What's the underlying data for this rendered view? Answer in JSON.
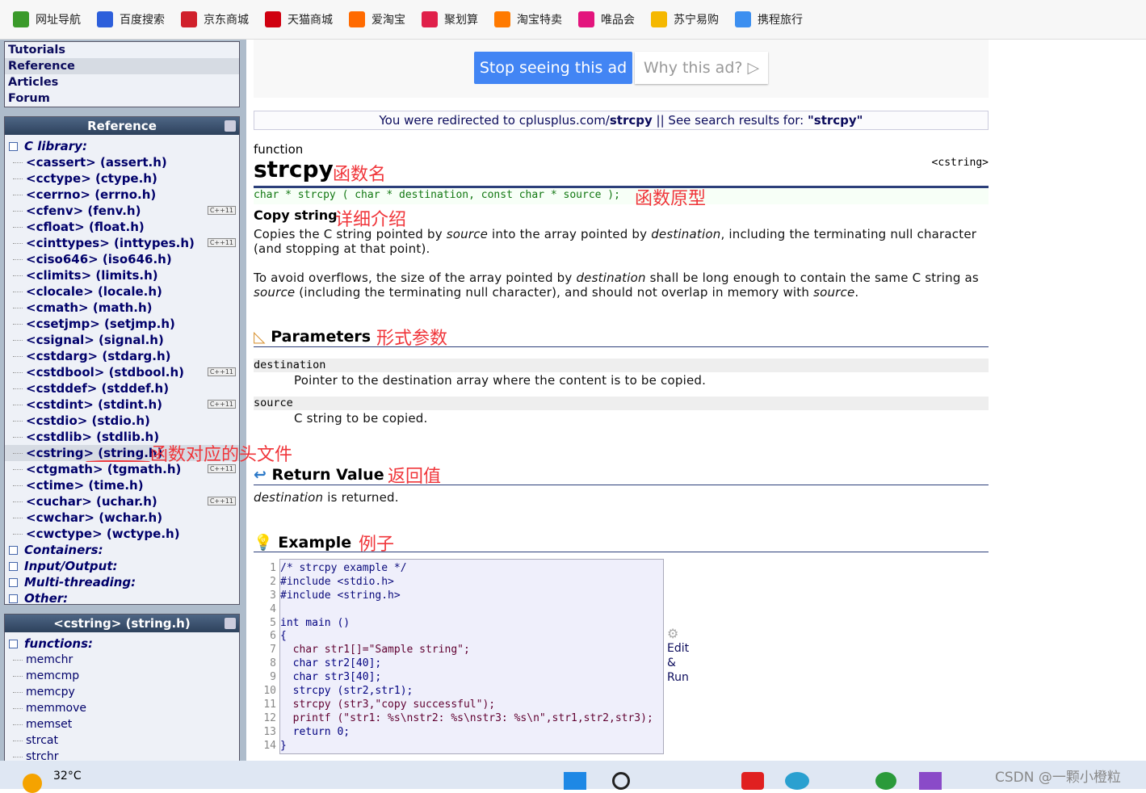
{
  "bookmarks": [
    {
      "label": "网址导航",
      "color": "#3a9a2a"
    },
    {
      "label": "百度搜索",
      "color": "#2d5fdb"
    },
    {
      "label": "京东商城",
      "color": "#d0202b"
    },
    {
      "label": "天猫商城",
      "color": "#d00010"
    },
    {
      "label": "爱淘宝",
      "color": "#ff6a00"
    },
    {
      "label": "聚划算",
      "color": "#e0204a"
    },
    {
      "label": "淘宝特卖",
      "color": "#ff7a00"
    },
    {
      "label": "唯品会",
      "color": "#e3157d"
    },
    {
      "label": "苏宁易购",
      "color": "#f5b800"
    },
    {
      "label": "携程旅行",
      "color": "#3c8ff0"
    }
  ],
  "nav": [
    "Tutorials",
    "Reference",
    "Articles",
    "Forum"
  ],
  "ref_panel": {
    "title": "Reference",
    "groups_top": "C library:",
    "headers": [
      {
        "label": "<cassert> (assert.h)"
      },
      {
        "label": "<cctype> (ctype.h)"
      },
      {
        "label": "<cerrno> (errno.h)"
      },
      {
        "label": "<cfenv> (fenv.h)",
        "cpp": "C++11"
      },
      {
        "label": "<cfloat> (float.h)"
      },
      {
        "label": "<cinttypes> (inttypes.h)",
        "cpp": "C++11"
      },
      {
        "label": "<ciso646> (iso646.h)"
      },
      {
        "label": "<climits> (limits.h)"
      },
      {
        "label": "<clocale> (locale.h)"
      },
      {
        "label": "<cmath> (math.h)"
      },
      {
        "label": "<csetjmp> (setjmp.h)"
      },
      {
        "label": "<csignal> (signal.h)"
      },
      {
        "label": "<cstdarg> (stdarg.h)"
      },
      {
        "label": "<cstdbool> (stdbool.h)",
        "cpp": "C++11"
      },
      {
        "label": "<cstddef> (stddef.h)"
      },
      {
        "label": "<cstdint> (stdint.h)",
        "cpp": "C++11"
      },
      {
        "label": "<cstdio> (stdio.h)"
      },
      {
        "label": "<cstdlib> (stdlib.h)"
      },
      {
        "label": "<cstring> (string.h)",
        "sel": true
      },
      {
        "label": "<ctgmath> (tgmath.h)",
        "cpp": "C++11"
      },
      {
        "label": "<ctime> (time.h)"
      },
      {
        "label": "<cuchar> (uchar.h)",
        "cpp": "C++11"
      },
      {
        "label": "<cwchar> (wchar.h)"
      },
      {
        "label": "<cwctype> (wctype.h)"
      }
    ],
    "groups": [
      "Containers:",
      "Input/Output:",
      "Multi-threading:",
      "Other:"
    ]
  },
  "str_panel": {
    "title": "<cstring> (string.h)",
    "group": "functions:",
    "items": [
      "memchr",
      "memcmp",
      "memcpy",
      "memmove",
      "memset",
      "strcat",
      "strchr"
    ]
  },
  "ad": {
    "stop": "Stop seeing this ad",
    "why": "Why this ad? ▷"
  },
  "redirect": {
    "prefix": "You were redirected to cplusplus.com/",
    "term": "strcpy",
    "sep": " || ",
    "see": "See search results for: ",
    "quoted": "\"strcpy\""
  },
  "doc": {
    "kind": "function",
    "name": "strcpy",
    "header": "<cstring>",
    "prototype": "char * strcpy ( char * destination, const char * source );",
    "summary": "Copy string",
    "p1a": "Copies the C string pointed by ",
    "p1b": "source",
    "p1c": " into the array pointed by ",
    "p1d": "destination",
    "p1e": ", including the terminating null character (and stopping at that point).",
    "p2a": "To avoid overflows, the size of the array pointed by ",
    "p2b": "destination",
    "p2c": " shall be long enough to contain the same C string as ",
    "p2d": "source",
    "p2e": " (including the terminating null character), and should not overlap in memory with ",
    "p2f": "source",
    "p2g": ".",
    "params_title": "Parameters",
    "params": [
      {
        "name": "destination",
        "desc": "Pointer to the destination array where the content is to be copied."
      },
      {
        "name": "source",
        "desc": "C string to be copied."
      }
    ],
    "return_title": "Return Value",
    "return_a": "destination",
    "return_b": " is returned.",
    "example_title": "Example",
    "code": [
      "/* strcpy example */",
      "#include <stdio.h>",
      "#include <string.h>",
      "",
      "int main ()",
      "{",
      "  char str1[]=\"Sample string\";",
      "  char str2[40];",
      "  char str3[40];",
      "  strcpy (str2,str1);",
      "  strcpy (str3,\"copy successful\");",
      "  printf (\"str1: %s\\nstr2: %s\\nstr3: %s\\n\",str1,str2,str3);",
      "  return 0;",
      "}"
    ],
    "edit": [
      "Edit",
      "&",
      "Run"
    ]
  },
  "annotations": {
    "name": "函数名",
    "proto": "函数原型",
    "detail": "详细介绍",
    "params": "形式参数",
    "header": "函数对应的头文件",
    "ret": "返回值",
    "example": "例子"
  },
  "taskbar": {
    "temp": "32°C",
    "watermark": "CSDN @一颗小橙粒"
  }
}
